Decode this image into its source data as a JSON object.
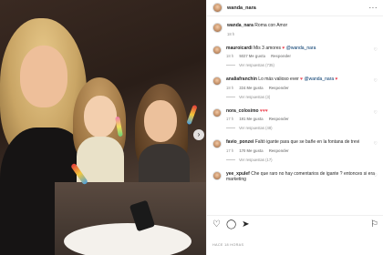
{
  "post": {
    "username": "wanda_nara",
    "more_icon": "more-horizontal-icon"
  },
  "caption": {
    "username": "wanda_nara",
    "text": "Roma con Amor",
    "time": "18 h"
  },
  "comments": [
    {
      "username": "mauroicardi",
      "text": "Mis 3 amores ",
      "emoji": "♥",
      "mention": "@wanda_nara",
      "time": "18 h",
      "likes": "5027 Me gusta",
      "reply": "Responder",
      "replies": "Ver respuestas (735)"
    },
    {
      "username": "analiafranchin",
      "text": "Lo más valioso ever ",
      "emoji": "♥",
      "mention": "@wanda_nara",
      "emoji2": "♥",
      "time": "18 h",
      "likes": "224 Me gusta",
      "reply": "Responder",
      "replies": "Ver respuestas (3)"
    },
    {
      "username": "nora_colosimo",
      "text": "",
      "emoji": "♥♥♥",
      "time": "17 h",
      "likes": "191 Me gusta",
      "reply": "Responder",
      "replies": "Ver respuestas (48)"
    },
    {
      "username": "favio_ponzei",
      "text": "Faltó igante para que se bañe en la fontana de trevi",
      "time": "17 h",
      "likes": "170 Me gusta",
      "reply": "Responder",
      "replies": "Ver respuestas (17)"
    },
    {
      "username": "yee_xpulef",
      "text": "Che que raro no hay comentarios de igante ? entonces si era marketing"
    }
  ],
  "actions": {
    "like_icon": "heart-icon",
    "comment_icon": "comment-icon",
    "share_icon": "share-icon",
    "save_icon": "bookmark-icon"
  },
  "date": "HACE 18 HORAS",
  "colors": {
    "mention": "#00376b",
    "heart": "#ed4956",
    "link": "#0095f6",
    "muted": "#8e8e8e"
  }
}
